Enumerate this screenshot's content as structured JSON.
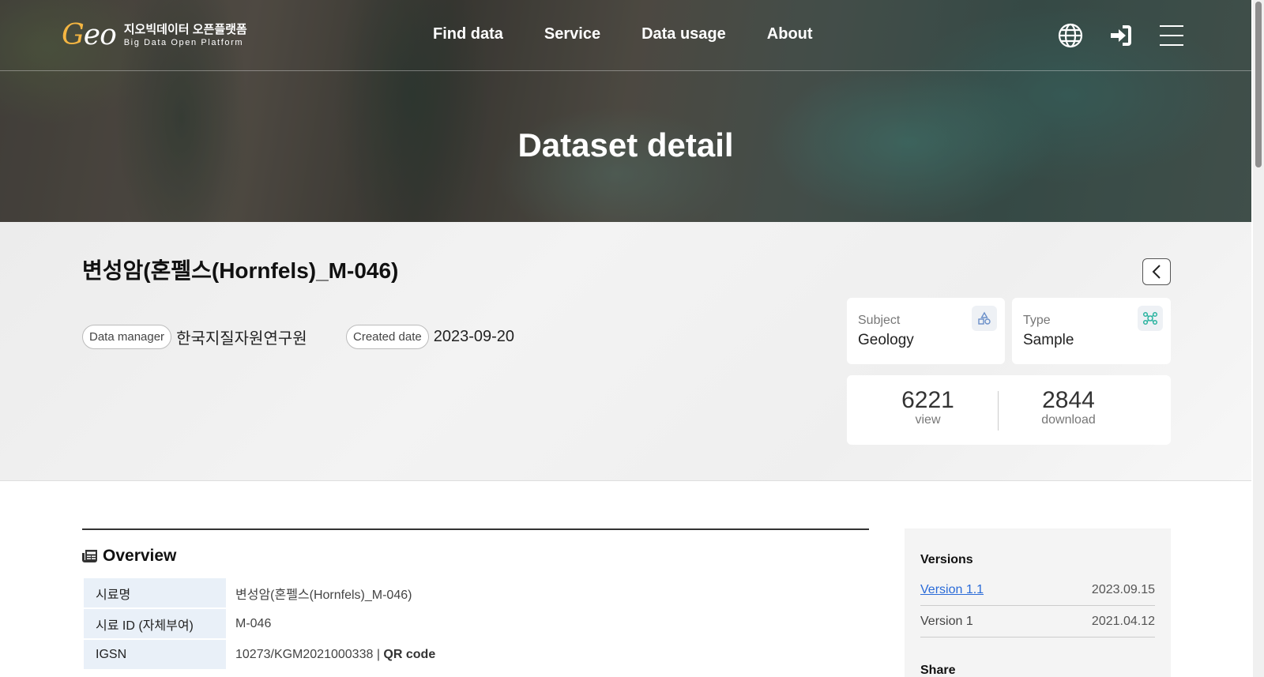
{
  "header": {
    "logo_mark": "Geo",
    "logo_ko": "지오빅데이터 오픈플랫폼",
    "logo_en": "Big Data Open Platform",
    "nav": [
      "Find data",
      "Service",
      "Data usage",
      "About"
    ],
    "icons": [
      "globe-icon",
      "login-icon",
      "menu-icon"
    ]
  },
  "hero": {
    "title": "Dataset detail"
  },
  "dataset": {
    "title": "변성암(혼펠스(Hornfels)_M-046)",
    "manager_label": "Data manager",
    "manager_value": "한국지질자원연구원",
    "created_label": "Created date",
    "created_value": "2023-09-20",
    "subject_label": "Subject",
    "subject_value": "Geology",
    "type_label": "Type",
    "type_value": "Sample",
    "views": "6221",
    "views_label": "view",
    "downloads": "2844",
    "downloads_label": "download"
  },
  "overview": {
    "title": "Overview",
    "rows": [
      {
        "key": "시료명",
        "value": "변성암(혼펠스(Hornfels)_M-046)"
      },
      {
        "key": "시료 ID (자체부여)",
        "value": "M-046"
      },
      {
        "key": "IGSN",
        "value": "10273/KGM2021000338 | ",
        "link": "QR code"
      }
    ]
  },
  "versions": {
    "title": "Versions",
    "items": [
      {
        "label": "Version 1.1",
        "date": "2023.09.15",
        "link": true
      },
      {
        "label": "Version 1",
        "date": "2021.04.12",
        "link": false
      }
    ],
    "share_label": "Share"
  },
  "colors": {
    "accent_link": "#2a6bd8",
    "key_bg": "#e9f0f8"
  }
}
